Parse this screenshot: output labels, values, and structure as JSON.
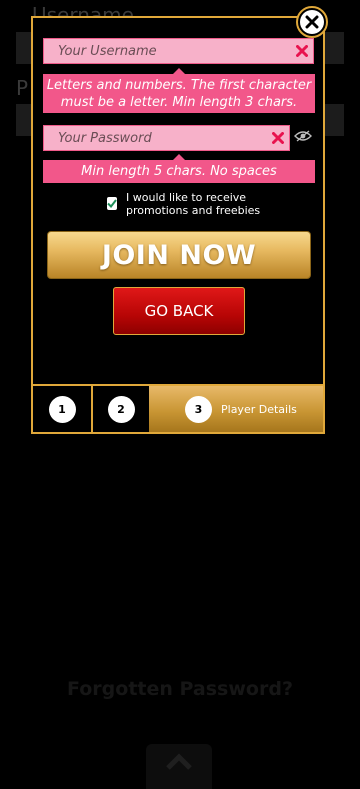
{
  "background": {
    "username_label": "Username",
    "password_label": "P",
    "forgot_link": "Forgotten Password?"
  },
  "modal": {
    "username_placeholder": "Your Username",
    "username_hint": "Letters and numbers. The first character must be a letter. Min length 3 chars.",
    "password_placeholder": "Your Password",
    "password_hint": "Min length 5 chars. No spaces",
    "promo_checkbox_label": "I would like to receive promotions and freebies",
    "promo_checked": true,
    "join_button": "JOIN NOW",
    "back_button": "GO BACK"
  },
  "steps": [
    {
      "number": "1",
      "label": ""
    },
    {
      "number": "2",
      "label": ""
    },
    {
      "number": "3",
      "label": "Player Details"
    }
  ],
  "icons": {
    "close": "close-icon",
    "clear": "clear-x-icon",
    "eye": "eye-icon",
    "check": "checkmark-icon",
    "up": "chevron-up-icon"
  },
  "colors": {
    "accent_gold": "#e0a83a",
    "error_pink": "#f2578a",
    "input_pink": "#f7b1c9",
    "back_red": "#b70505"
  }
}
